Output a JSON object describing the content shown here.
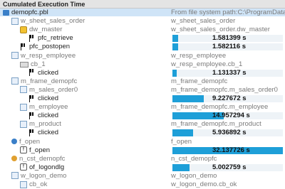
{
  "header": {
    "title": "Cumulated Execution Time"
  },
  "root": {
    "label": "demopfc.pbl",
    "path": "From file system path:C:\\ProgramData\\No"
  },
  "rows": [
    {
      "indent": 1,
      "icon": "tree-icon",
      "label": "w_sheet_sales_order",
      "gray": true,
      "right": "w_sheet_sales_order"
    },
    {
      "indent": 2,
      "icon": "badge-icon",
      "label": "dw_master",
      "gray": true,
      "right": "w_sheet_sales_order.dw_master"
    },
    {
      "indent": 3,
      "icon": "flag-icon",
      "label": "pfc_retrieve",
      "gray": false,
      "value": "1.581399 s",
      "frac": 0.049
    },
    {
      "indent": 2,
      "icon": "flag-icon",
      "label": "pfc_postopen",
      "gray": false,
      "value": "1.582116 s",
      "frac": 0.049
    },
    {
      "indent": 1,
      "icon": "tree-icon",
      "label": "w_resp_employee",
      "gray": true,
      "right": "w_resp_employee"
    },
    {
      "indent": 2,
      "icon": "button-icon",
      "label": "cb_1",
      "gray": true,
      "right": "w_resp_employee.cb_1"
    },
    {
      "indent": 3,
      "icon": "flag-icon",
      "label": "clicked",
      "gray": false,
      "value": "1.131337 s",
      "frac": 0.035
    },
    {
      "indent": 1,
      "icon": "tree-icon",
      "label": "m_frame_demopfc",
      "gray": true,
      "right": "m_frame_demopfc"
    },
    {
      "indent": 2,
      "icon": "tree-icon",
      "label": "m_sales_order0",
      "gray": true,
      "right": "m_frame_demopfc.m_sales_order0"
    },
    {
      "indent": 3,
      "icon": "flag-icon",
      "label": "clicked",
      "gray": false,
      "value": "9.227672 s",
      "frac": 0.287
    },
    {
      "indent": 2,
      "icon": "tree-icon",
      "label": "m_employee",
      "gray": true,
      "right": "m_frame_demopfc.m_employee"
    },
    {
      "indent": 3,
      "icon": "flag-icon",
      "label": "clicked",
      "gray": false,
      "value": "14.957294 s",
      "frac": 0.465
    },
    {
      "indent": 2,
      "icon": "tree-icon",
      "label": "m_product",
      "gray": true,
      "right": "m_frame_demopfc.m_product"
    },
    {
      "indent": 3,
      "icon": "flag-icon",
      "label": "clicked",
      "gray": false,
      "value": "5.936892 s",
      "frac": 0.185
    },
    {
      "indent": 1,
      "icon": "gear-icon",
      "label": "f_open",
      "gray": true,
      "right": "f_open"
    },
    {
      "indent": 2,
      "icon": "function-icon",
      "label": "f_open",
      "gray": false,
      "value": "32.137726 s",
      "frac": 1.0
    },
    {
      "indent": 1,
      "icon": "person-icon",
      "label": "n_cst_demopfc",
      "gray": true,
      "right": "n_cst_demopfc"
    },
    {
      "indent": 2,
      "icon": "function-icon",
      "label": "of_logondlg",
      "gray": false,
      "value": "5.002759 s",
      "frac": 0.156
    },
    {
      "indent": 1,
      "icon": "tree-icon",
      "label": "w_logon_demo",
      "gray": true,
      "right": "w_logon_demo"
    },
    {
      "indent": 2,
      "icon": "tree-icon",
      "label": "cb_ok",
      "gray": true,
      "right": "w_logon_demo.cb_ok"
    }
  ],
  "colors": {
    "bar": "#1e9fd8",
    "selection": "#cfe4f7"
  }
}
